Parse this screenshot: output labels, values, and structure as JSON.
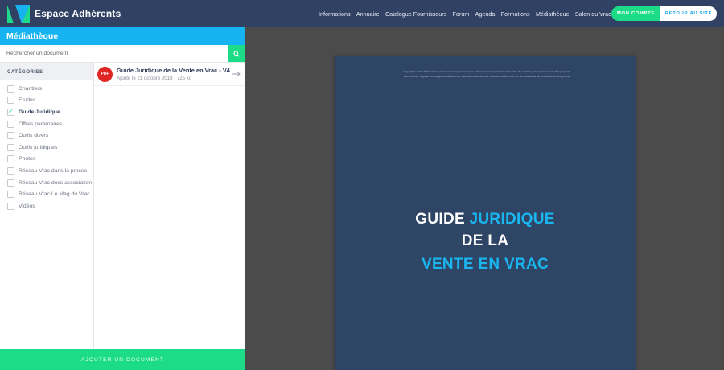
{
  "brand": {
    "name": "Espace Adhérents",
    "logo_icon": "espace-adherents-logo"
  },
  "nav": [
    {
      "label": "Informations"
    },
    {
      "label": "Annuaire"
    },
    {
      "label": "Catalogue Fournisseurs"
    },
    {
      "label": "Forum"
    },
    {
      "label": "Agenda"
    },
    {
      "label": "Formations"
    },
    {
      "label": "Médiathèque"
    },
    {
      "label": "Salon du Vrac"
    }
  ],
  "buttons": {
    "account": "MON COMPTE",
    "back": "RETOUR AU SITE"
  },
  "panel": {
    "title": "Médiathèque",
    "search_placeholder": "Rechercher un document",
    "categories_title": "CATÉGORIES",
    "categories": [
      {
        "label": "Chantiers",
        "checked": false
      },
      {
        "label": "Etudes",
        "checked": false
      },
      {
        "label": "Guide Juridique",
        "checked": true
      },
      {
        "label": "Offres partenaires",
        "checked": false
      },
      {
        "label": "Outils divers",
        "checked": false
      },
      {
        "label": "Outils juridiques",
        "checked": false
      },
      {
        "label": "Photos",
        "checked": false
      },
      {
        "label": "Réseau Vrac dans la presse",
        "checked": false
      },
      {
        "label": "Réseau Vrac docs association",
        "checked": false
      },
      {
        "label": "Réseau Vrac Le Mag du Vrac",
        "checked": false
      },
      {
        "label": "Vidéos",
        "checked": false
      }
    ],
    "documents": [
      {
        "badge": "PDF",
        "title": "Guide Juridique de la Vente en Vrac - V4",
        "added": "Ajouté le 21 octobre 2018",
        "size": "725 ko"
      }
    ],
    "add_button": "AJOUTER UN DOCUMENT"
  },
  "viewer": {
    "copyright": "Copyright© Toute diffusion de ce document à des personnes non adhérentes de l'association est passible de sanctions prévues par le code de la propriété intellectuelle. Ce guide est la propriété exclusive de l'association Réseau Vrac. Il est strictement réservé à la consultation par ses adhérents uniquement.",
    "line1_a": "GUIDE",
    "line1_b": "JURIDIQUE",
    "line2": "DE LA",
    "line3": "VENTE EN VRAC"
  },
  "colors": {
    "nav_bg": "#304163",
    "accent_blue": "#15b3f0",
    "accent_green": "#1ddc87",
    "pdf_red": "#e02525",
    "page_bg": "#2f4566"
  }
}
